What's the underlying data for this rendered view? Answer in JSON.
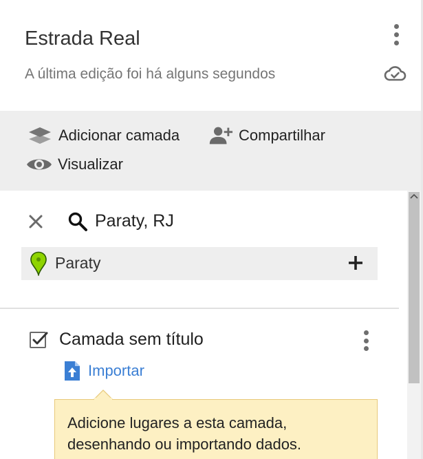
{
  "header": {
    "title": "Estrada Real",
    "subtitle": "A última edição foi há alguns segundos",
    "menu_icon": "more-vert-icon",
    "sync_icon": "cloud-done-icon"
  },
  "toolbar": {
    "add_layer_label": "Adicionar camada",
    "share_label": "Compartilhar",
    "preview_label": "Visualizar"
  },
  "search": {
    "query": "Paraty, RJ",
    "results": [
      {
        "label": "Paraty",
        "pin_color": "#8fd400"
      }
    ]
  },
  "layer": {
    "title": "Camada sem título",
    "checked": true,
    "import_label": "Importar"
  },
  "tooltip": {
    "text": "Adicione lugares a esta camada, desenhando ou importando dados."
  },
  "colors": {
    "toolbar_bg": "#eeeeee",
    "link_blue": "#3b7fd4",
    "tooltip_bg": "#fdf0c3"
  }
}
